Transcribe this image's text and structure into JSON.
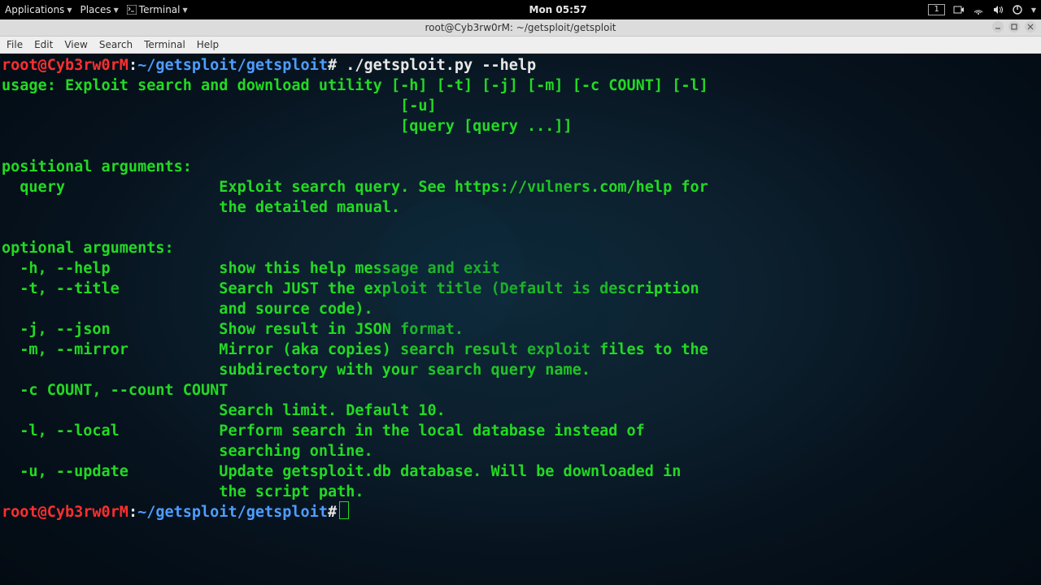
{
  "topbar": {
    "applications": "Applications",
    "places": "Places",
    "terminal": "Terminal",
    "clock": "Mon 05:57",
    "workspace": "1"
  },
  "window": {
    "title": "root@Cyb3rw0rM: ~/getsploit/getsploit"
  },
  "menubar": {
    "file": "File",
    "edit": "Edit",
    "view": "View",
    "search": "Search",
    "terminal": "Terminal",
    "help": "Help"
  },
  "prompt": {
    "user": "root@Cyb3rw0rM",
    "sep": ":",
    "path": "~/getsploit/getsploit",
    "sym": "#"
  },
  "cmd": {
    "run": "./getsploit.py --help"
  },
  "out": {
    "u0": "usage: Exploit search and download utility [-h] [-t] [-j] [-m] [-c COUNT] [-l]",
    "u1": "                                            [-u]",
    "u2": "                                            [query [query ...]]",
    "pa": "positional arguments:",
    "pa0": "  query                 Exploit search query. See https://vulners.com/help for",
    "pa1": "                        the detailed manual.",
    "oa": "optional arguments:",
    "h0": "  -h, --help            show this help message and exit",
    "t0": "  -t, --title           Search JUST the exploit title (Default is description",
    "t1": "                        and source code).",
    "j0": "  -j, --json            Show result in JSON format.",
    "m0": "  -m, --mirror          Mirror (aka copies) search result exploit files to the",
    "m1": "                        subdirectory with your search query name.",
    "c0": "  -c COUNT, --count COUNT",
    "c1": "                        Search limit. Default 10.",
    "l0": "  -l, --local           Perform search in the local database instead of",
    "l1": "                        searching online.",
    "uu0": "  -u, --update          Update getsploit.db database. Will be downloaded in",
    "uu1": "                        the script path."
  }
}
